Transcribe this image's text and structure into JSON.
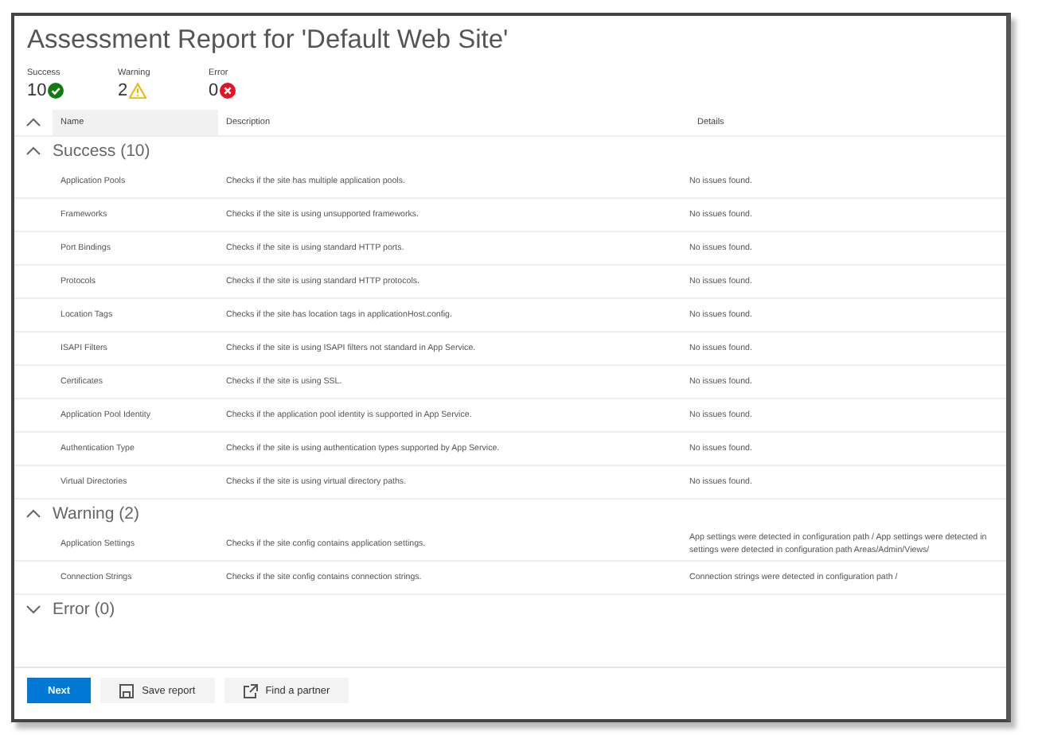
{
  "title": "Assessment Report for 'Default Web Site'",
  "summary": [
    {
      "kind": "success",
      "label": "Success",
      "count": "10"
    },
    {
      "kind": "warning",
      "label": "Warning",
      "count": "2"
    },
    {
      "kind": "error",
      "label": "Error",
      "count": "0"
    }
  ],
  "table": {
    "columns": [
      "Name",
      "Description",
      "Details"
    ],
    "groups": [
      {
        "title": "Success (10)",
        "expanded": true,
        "rows": [
          {
            "name": "Application Pools",
            "description": "Checks if the site has multiple application pools.",
            "details": [
              "No issues found."
            ]
          },
          {
            "name": "Frameworks",
            "description": "Checks if the site is using unsupported frameworks.",
            "details": [
              "No issues found."
            ]
          },
          {
            "name": "Port Bindings",
            "description": "Checks if the site is using standard HTTP ports.",
            "details": [
              "No issues found."
            ]
          },
          {
            "name": "Protocols",
            "description": "Checks if the site is using standard HTTP protocols.",
            "details": [
              "No issues found."
            ]
          },
          {
            "name": "Location Tags",
            "description": "Checks if the site has location tags in applicationHost.config.",
            "details": [
              "No issues found."
            ]
          },
          {
            "name": "ISAPI Filters",
            "description": "Checks if the site is using ISAPI filters not standard in App Service.",
            "details": [
              "No issues found."
            ]
          },
          {
            "name": "Certificates",
            "description": "Checks if the site is using SSL.",
            "details": [
              "No issues found."
            ]
          },
          {
            "name": "Application Pool Identity",
            "description": "Checks if the application pool identity is supported in App Service.",
            "details": [
              "No issues found."
            ]
          },
          {
            "name": "Authentication Type",
            "description": "Checks if the site is using authentication types supported by App Service.",
            "details": [
              "No issues found."
            ]
          },
          {
            "name": "Virtual Directories",
            "description": "Checks if the site is using virtual directory paths.",
            "details": [
              "No issues found."
            ]
          }
        ]
      },
      {
        "title": "Warning (2)",
        "expanded": true,
        "rows": [
          {
            "name": "Application Settings",
            "description": "Checks if the site config contains application settings.",
            "details": [
              "App settings were detected in configuration path / App settings were detected in",
              "settings were detected in configuration path Areas/Admin/Views/"
            ]
          },
          {
            "name": "Connection Strings",
            "description": "Checks if the site config contains connection strings.",
            "details": [
              "Connection strings were detected in configuration path /"
            ]
          }
        ]
      },
      {
        "title": "Error (0)",
        "expanded": false
      }
    ]
  },
  "buttons": [
    {
      "kind": "primary",
      "label": "Next"
    },
    {
      "kind": "save",
      "label": "Save report"
    },
    {
      "kind": "external",
      "label": "Find a partner"
    }
  ]
}
